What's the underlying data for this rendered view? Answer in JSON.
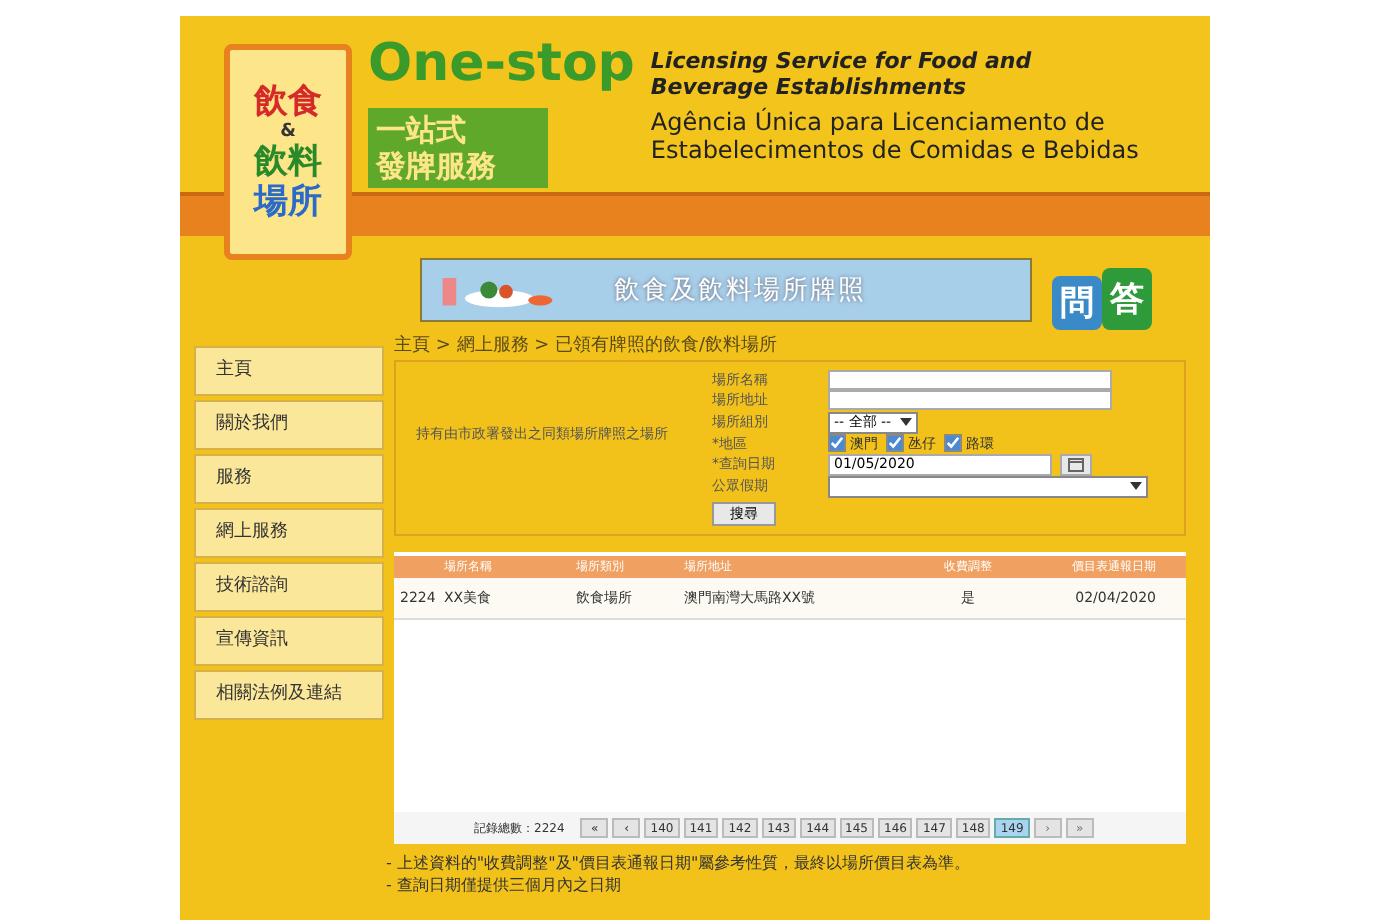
{
  "header": {
    "logo_lines": [
      "飲食",
      "&",
      "飲料",
      "場所"
    ],
    "brand": "One-stop",
    "brand_cn": [
      "一站式",
      "發牌服務"
    ],
    "title_en": [
      "Licensing Service for Food and",
      "Beverage Establishments"
    ],
    "title_pt": [
      "Agência Única para Licenciamento de",
      "Estabelecimentos de Comidas e Bebidas"
    ]
  },
  "banner": {
    "text": "飲食及飲料場所牌照",
    "qa": [
      "問",
      "答"
    ]
  },
  "sidebar": {
    "items": [
      "主頁",
      "關於我們",
      "服務",
      "網上服務",
      "技術諮詢",
      "宣傳資訊",
      "相關法例及連結"
    ]
  },
  "breadcrumb": "主頁 > 網上服務 > 已領有牌照的飲食/飲料場所",
  "search": {
    "description": "持有由市政署發出之同類場所牌照之場所",
    "fields": [
      {
        "kind": "text",
        "label": "場所名稱"
      },
      {
        "kind": "text",
        "label": "場所地址"
      },
      {
        "kind": "select",
        "label": "場所組別",
        "value": "-- 全部 --"
      },
      {
        "kind": "checks",
        "label": "*地區",
        "options": [
          {
            "label": "澳門",
            "checked": true
          },
          {
            "label": "氹仔",
            "checked": true
          },
          {
            "label": "路環",
            "checked": true
          }
        ]
      },
      {
        "kind": "date",
        "label": "*查詢日期",
        "value": "01/05/2020"
      },
      {
        "kind": "wideselect",
        "label": "公眾假期"
      }
    ],
    "button": "搜尋"
  },
  "table": {
    "columns": [
      "",
      "場所名稱",
      "場所類別",
      "場所地址",
      "收費調整",
      "價目表通報日期"
    ],
    "rows": [
      [
        "2224",
        "XX美食",
        "飲食場所",
        "澳門南灣大馬路XX號",
        "是",
        "02/04/2020"
      ]
    ]
  },
  "pagination": {
    "total": "記錄總數：2224",
    "first": "«",
    "prev": "‹",
    "next": "›",
    "last": "»",
    "pages": [
      {
        "label": "140",
        "selected": false
      },
      {
        "label": "141",
        "selected": false
      },
      {
        "label": "142",
        "selected": false
      },
      {
        "label": "143",
        "selected": false
      },
      {
        "label": "144",
        "selected": false
      },
      {
        "label": "145",
        "selected": false
      },
      {
        "label": "146",
        "selected": false
      },
      {
        "label": "147",
        "selected": false
      },
      {
        "label": "148",
        "selected": false
      },
      {
        "label": "149",
        "selected": true
      }
    ]
  },
  "notes": [
    "- 上述資料的\"收費調整\"及\"價目表通報日期\"屬參考性質，最終以場所價目表為準。",
    "- 查詢日期僅提供三個月內之日期"
  ]
}
